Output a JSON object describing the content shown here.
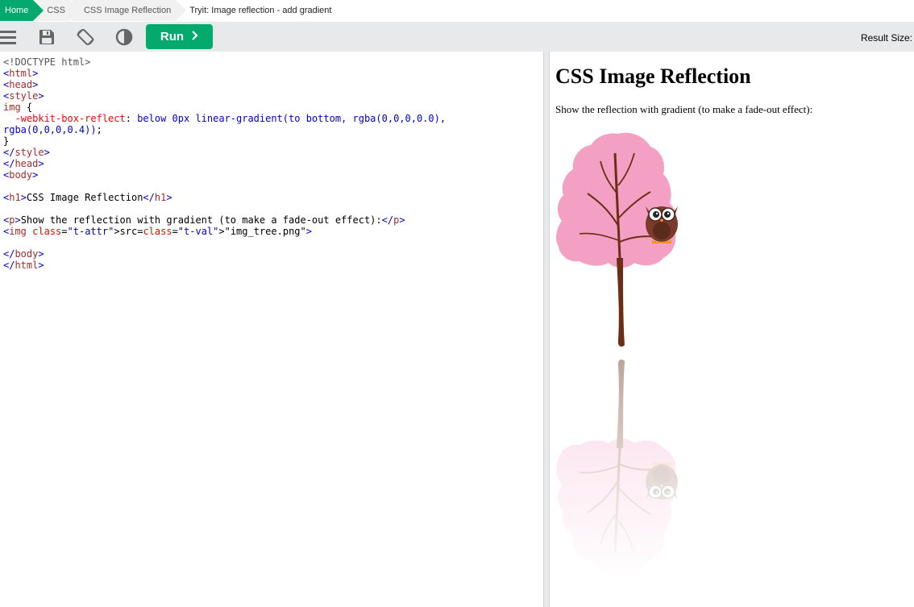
{
  "breadcrumb": {
    "items": [
      "Home",
      "CSS",
      "CSS Image Reflection"
    ],
    "current": "Tryit: Image reflection - add gradient"
  },
  "toolbar": {
    "icons": [
      "menu-icon",
      "save-icon",
      "rotate-icon",
      "contrast-icon"
    ],
    "run_label": "Run",
    "result_size_label": "Result Size:"
  },
  "colors": {
    "accent": "#04aa6d",
    "toolbar_bg": "#e7e9eb",
    "tree_pink": "#f4a0c4",
    "trunk": "#6b2e14",
    "owl": "#7b3b2a"
  },
  "editor": {
    "lines": [
      "<!DOCTYPE html>",
      "<html>",
      "<head>",
      "<style>",
      "img {",
      "  -webkit-box-reflect: below 0px linear-gradient(to bottom, rgba(0,0,0,0.0),",
      "rgba(0,0,0,0.4));",
      "}",
      "</style>",
      "</head>",
      "<body>",
      "",
      "<h1>CSS Image Reflection</h1>",
      "",
      "<p>Show the reflection with gradient (to make a fade-out effect):</p>",
      "<img src=\"img_tree.png\">",
      "",
      "</body>",
      "</html>"
    ]
  },
  "result": {
    "title": "CSS Image Reflection",
    "paragraph": "Show the reflection with gradient (to make a fade-out effect):"
  }
}
